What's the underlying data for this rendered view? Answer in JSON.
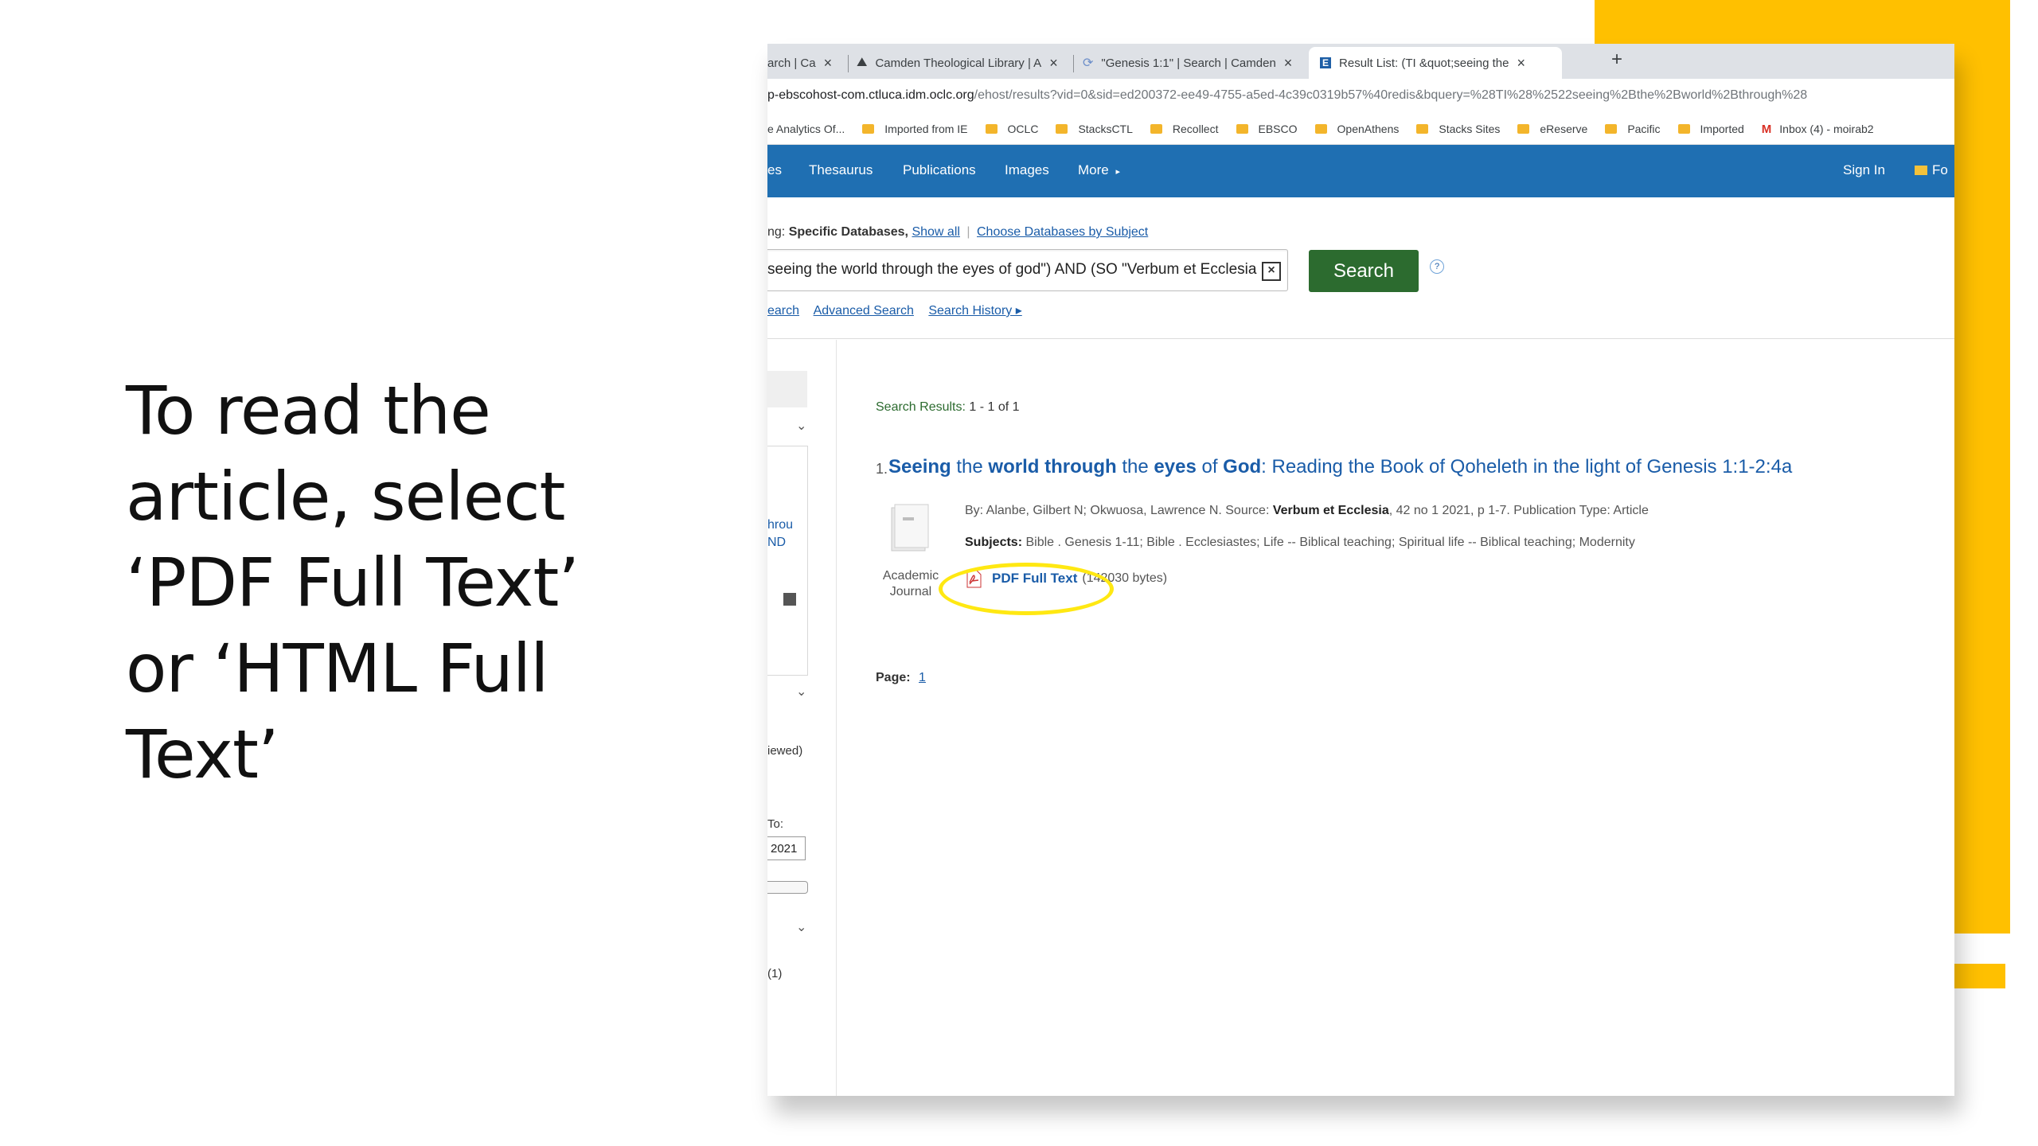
{
  "instruction": {
    "line1": "To read the",
    "line2": "article, select",
    "line3": "‘PDF Full Text’",
    "line4": "or ‘HTML Full",
    "line5": "Text’"
  },
  "browser": {
    "tabs": [
      {
        "label": "arch | Ca"
      },
      {
        "label": "Camden Theological Library | A"
      },
      {
        "label": "\"Genesis 1:1\" | Search | Camden"
      },
      {
        "label": "Result List: (TI &quot;seeing the"
      }
    ],
    "new_tab": "+",
    "url_host": "p-ebscohost-com.ctluca.idm.oclc.org",
    "url_path": "/ehost/results?vid=0&sid=ed200372-ee49-4755-a5ed-4c39c0319b57%40redis&bquery=%28TI%28%2522seeing%2Bthe%2Bworld%2Bthrough%28",
    "bookmarks": [
      {
        "label": "e Analytics Of...",
        "icon": "none"
      },
      {
        "label": "Imported from IE",
        "icon": "folder"
      },
      {
        "label": "OCLC",
        "icon": "folder"
      },
      {
        "label": "StacksCTL",
        "icon": "folder"
      },
      {
        "label": "Recollect",
        "icon": "folder"
      },
      {
        "label": "EBSCO",
        "icon": "folder"
      },
      {
        "label": "OpenAthens",
        "icon": "folder"
      },
      {
        "label": "Stacks Sites",
        "icon": "folder"
      },
      {
        "label": "eReserve",
        "icon": "folder"
      },
      {
        "label": "Pacific",
        "icon": "folder"
      },
      {
        "label": "Imported",
        "icon": "folder"
      },
      {
        "label": "Inbox (4) - moirab2",
        "icon": "gmail"
      }
    ]
  },
  "nav": {
    "partial": "es",
    "thesaurus": "Thesaurus",
    "publications": "Publications",
    "images": "Images",
    "more": "More",
    "more_caret": "▸",
    "sign_in": "Sign In",
    "folder": "Fo"
  },
  "search": {
    "searching_prefix": "ng:",
    "searching_value": "Specific Databases,",
    "show_all": "Show all",
    "choose_db": "Choose Databases by Subject",
    "query": "seeing the world through the eyes of god\") AND (SO \"Verbum et Ecclesia\")",
    "button": "Search",
    "help": "?",
    "link_basic": "earch",
    "link_advanced": "Advanced Search",
    "link_history": "Search History ▸"
  },
  "left_panel": {
    "link1": "hrou",
    "link2": "ND",
    "viewed": "iewed)",
    "to_label": "To:",
    "to_value": "2021",
    "count": "(1)",
    "chevron": "⌄"
  },
  "results": {
    "count_label": "Search Results:",
    "count_value": "1 - 1 of 1",
    "items": [
      {
        "number": "1.",
        "title_parts": [
          {
            "text": "Seeing",
            "bold": true
          },
          {
            "text": " the ",
            "bold": false
          },
          {
            "text": "world through",
            "bold": true
          },
          {
            "text": " the ",
            "bold": false
          },
          {
            "text": "eyes",
            "bold": true
          },
          {
            "text": " of ",
            "bold": false
          },
          {
            "text": "God",
            "bold": true
          },
          {
            "text": ": Reading the Book of Qoheleth in the light of Genesis 1:1-2:4a",
            "bold": false
          }
        ],
        "doc_type_line1": "Academic",
        "doc_type_line2": "Journal",
        "meta_prefix": "By: Alanbe, Gilbert N; Okwuosa, Lawrence N. Source:",
        "meta_source": "Verbum et Ecclesia",
        "meta_suffix": ", 42 no 1 2021, p 1-7. Publication Type: Article",
        "subjects_label": "Subjects:",
        "subjects_value": "Bible . Genesis 1-11; Bible . Ecclesiastes; Life -- Biblical teaching; Spiritual life -- Biblical teaching; Modernity",
        "pdf_label": "PDF Full Text",
        "pdf_size": "(142030 bytes)"
      }
    ],
    "page_label": "Page:",
    "page_value": "1"
  },
  "colors": {
    "accent": "#FFC000",
    "nav_blue": "#1f6fb2",
    "search_green": "#2c6b2f",
    "link_blue": "#1a5ca8",
    "highlight": "#ffe812"
  }
}
